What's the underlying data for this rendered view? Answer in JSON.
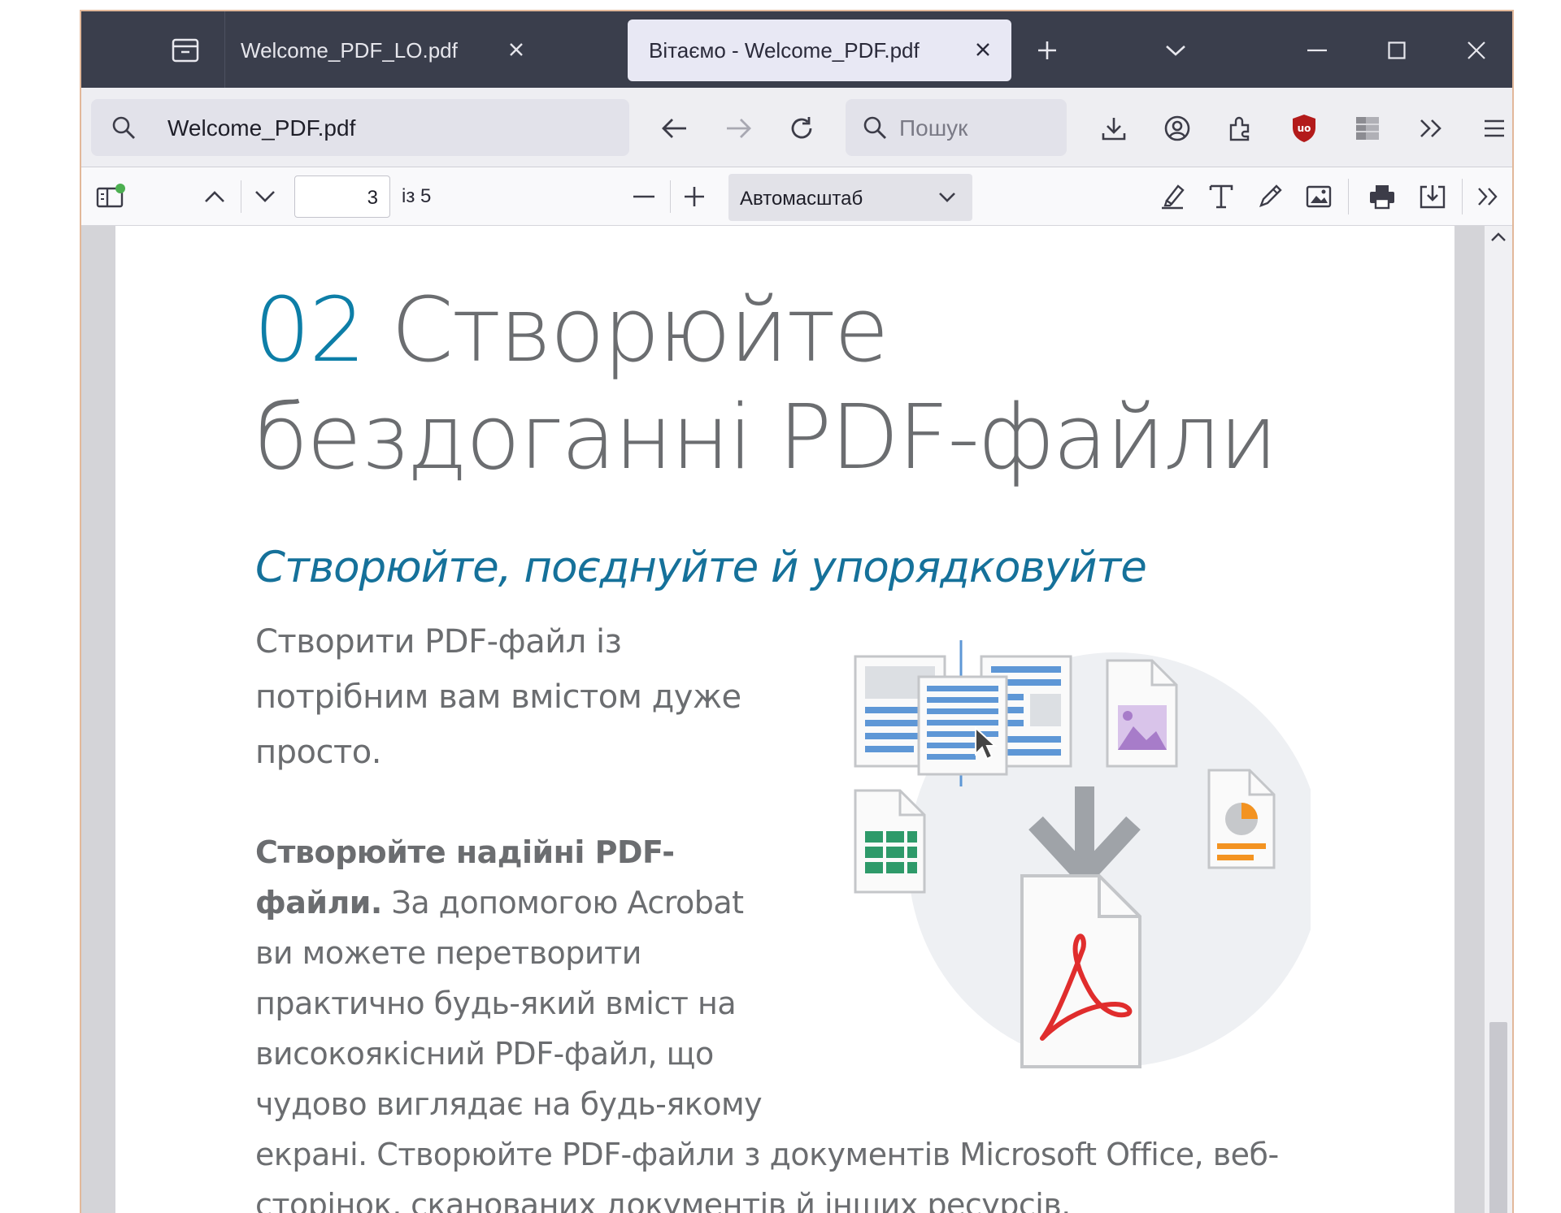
{
  "browser": {
    "tabs": [
      {
        "label": "Welcome_PDF_LO.pdf",
        "active": false
      },
      {
        "label": "Вітаємо - Welcome_PDF.pdf",
        "active": true
      }
    ],
    "address": {
      "value": "Welcome_PDF.pdf"
    },
    "search": {
      "placeholder": "Пошук"
    },
    "icons": [
      "tab-manager-icon",
      "close-icon",
      "new-tab-icon",
      "list-all-tabs-icon",
      "minimize-icon",
      "maximize-icon",
      "window-close-icon",
      "search-icon",
      "back-icon",
      "forward-icon",
      "reload-icon",
      "download-icon",
      "account-icon",
      "extensions-icon",
      "ublock-icon",
      "container-icon",
      "overflow-icon",
      "menu-icon"
    ]
  },
  "pdf_toolbar": {
    "page_number": "3",
    "page_count_label": "із 5",
    "zoom_label": "Автомасштаб"
  },
  "page": {
    "heading_number": "02",
    "heading_line1": "Створюйте",
    "heading_line2": "бездоганні PDF-файли",
    "subtitle": "Створюйте, поєднуйте й упорядковуйте",
    "intro_lines": [
      "Створити PDF-файл із",
      "потрібним вам вмістом дуже",
      "просто."
    ],
    "bold_line1": "Створюйте надійні PDF-",
    "bold_line2_bold": "файли.",
    "bold_line2_rest": " За допомогою Acrobat",
    "body_lines": [
      "ви можете перетворити",
      "практично будь-який вміст на",
      "високоякісний PDF-файл, що",
      "чудово виглядає на будь-якому",
      "екрані. Створюйте PDF-файли з документів Microsoft Office, веб-",
      "сторінок, сканованих документів й інших ресурсів."
    ]
  },
  "colors": {
    "accent_blue": "#0d7ea7",
    "subtitle_blue": "#15719a",
    "body_gray": "#6b6d70",
    "tab_bar": "#3a3e4c",
    "acrobat_red": "#e02d2d",
    "ublock_red": "#b31b1b"
  }
}
